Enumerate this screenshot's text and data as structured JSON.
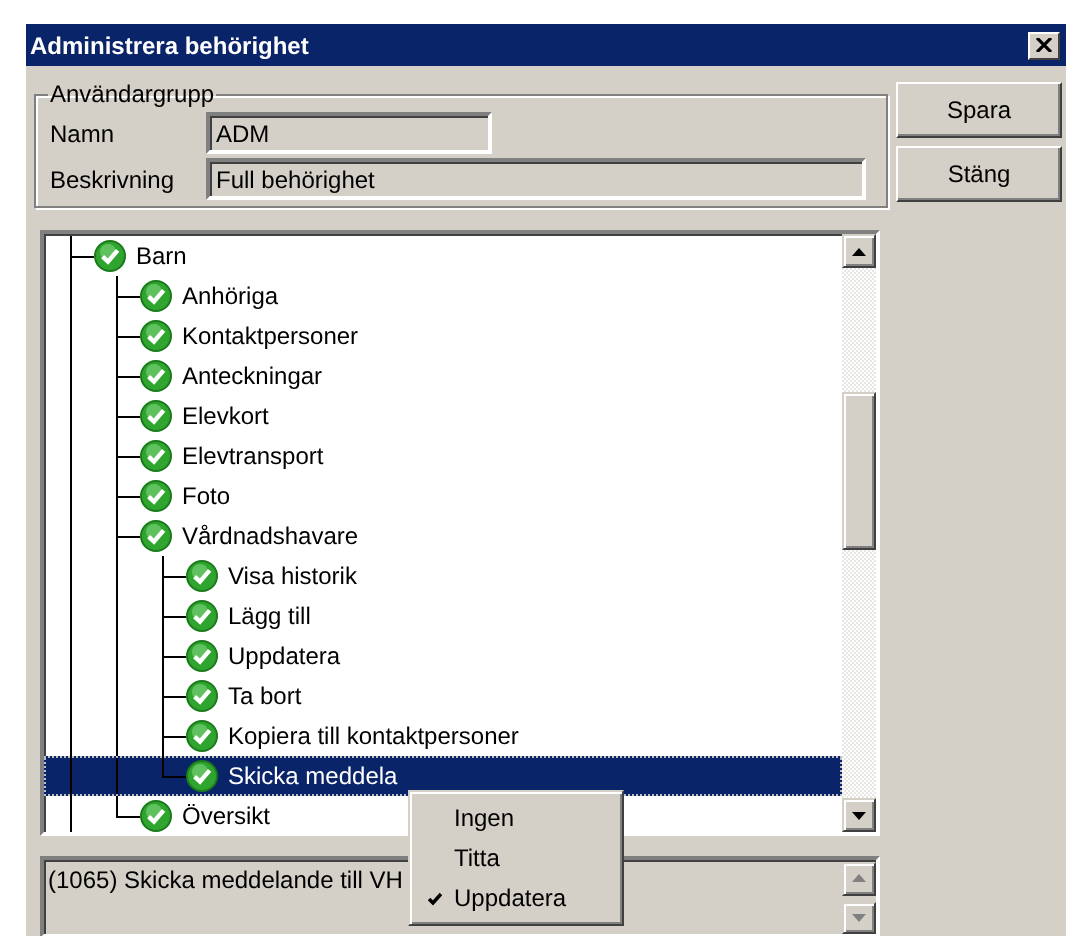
{
  "window": {
    "title": "Administrera behörighet"
  },
  "user_group": {
    "legend": "Användargrupp",
    "fields": [
      {
        "label": "Namn",
        "value": "ADM"
      },
      {
        "label": "Beskrivning",
        "value": "Full behörighet"
      }
    ]
  },
  "buttons": [
    "Spara",
    "Stäng"
  ],
  "tree": {
    "items": [
      {
        "label": "Barn",
        "selected": false,
        "children": [
          {
            "label": "Anhöriga",
            "selected": false
          },
          {
            "label": "Kontaktpersoner",
            "selected": false
          },
          {
            "label": "Anteckningar",
            "selected": false
          },
          {
            "label": "Elevkort",
            "selected": false
          },
          {
            "label": "Elevtransport",
            "selected": false
          },
          {
            "label": "Foto",
            "selected": false
          },
          {
            "label": "Vårdnadshavare",
            "selected": false,
            "children": [
              {
                "label": "Visa historik",
                "selected": false
              },
              {
                "label": "Lägg till",
                "selected": false
              },
              {
                "label": "Uppdatera",
                "selected": false
              },
              {
                "label": "Ta bort",
                "selected": false
              },
              {
                "label": "Kopiera till kontaktpersoner",
                "selected": false
              },
              {
                "label": "Skicka meddela",
                "selected": true
              }
            ]
          },
          {
            "label": "Översikt",
            "selected": false
          }
        ]
      }
    ]
  },
  "description": {
    "text": "(1065) Skicka meddelande till VH"
  },
  "context_menu": {
    "items": [
      {
        "label": "Ingen",
        "checked": false
      },
      {
        "label": "Titta",
        "checked": false
      },
      {
        "label": "Uppdatera",
        "checked": true
      }
    ]
  }
}
